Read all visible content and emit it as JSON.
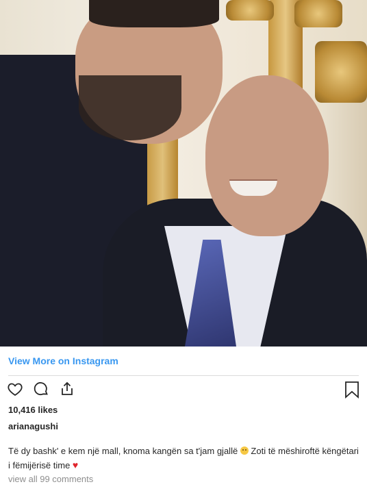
{
  "post": {
    "photo_alt": "selfie",
    "view_more_label": "View More on Instagram",
    "likes_label": "10,416 likes",
    "username": "arianagushi",
    "caption_part1": "Të dy bashk' e kem një mall, knoma kangën sa t'jam gjallë ",
    "caption_part2": " Zoti të mëshiroftë këngëtari i fëmijërisë time ",
    "view_comments_label": "view all 99 comments"
  },
  "icons": {
    "like": "heart-outline-icon",
    "comment": "comment-bubble-icon",
    "share": "share-upload-icon",
    "save": "bookmark-icon",
    "sad_face": "sad-face-emoji",
    "heart": "red-heart-emoji"
  },
  "colors": {
    "link": "#3897f0",
    "heart": "#e0242c",
    "muted": "#8e8e8e"
  }
}
